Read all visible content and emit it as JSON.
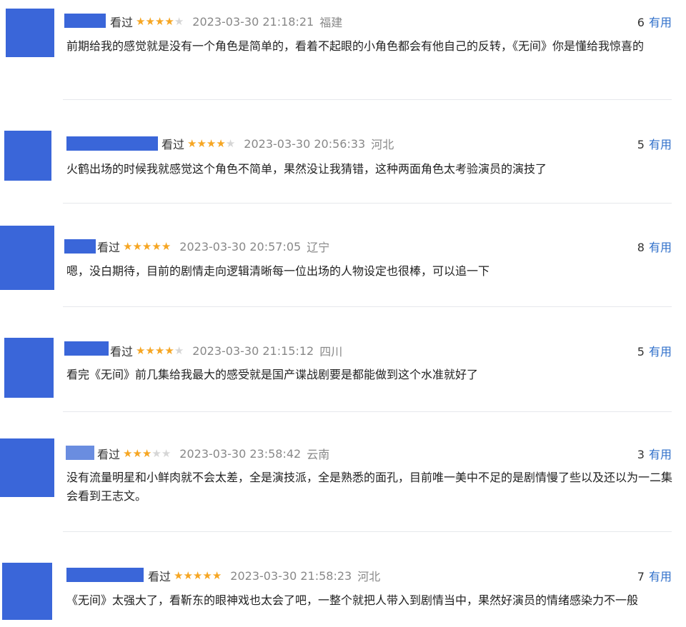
{
  "reviews": [
    {
      "watched": "看过",
      "rating": 4,
      "time": "2023-03-30 21:18:21",
      "region": "福建",
      "useful_count": "6",
      "useful_label": "有用",
      "content": "前期给我的感觉就是没有一个角色是简单的，看着不起眼的小角色都会有他自己的反转，《无间》你是懂给我惊喜的"
    },
    {
      "watched": "看过",
      "rating": 4,
      "time": "2023-03-30 20:56:33",
      "region": "河北",
      "useful_count": "5",
      "useful_label": "有用",
      "content": "火鹤出场的时候我就感觉这个角色不简单，果然没让我猜错，这种两面角色太考验演员的演技了"
    },
    {
      "watched": "看过",
      "rating": 5,
      "time": "2023-03-30 20:57:05",
      "region": "辽宁",
      "useful_count": "8",
      "useful_label": "有用",
      "content": "嗯，没白期待，目前的剧情走向逻辑清晰每一位出场的人物设定也很棒，可以追一下"
    },
    {
      "watched": "看过",
      "rating": 4,
      "time": "2023-03-30 21:15:12",
      "region": "四川",
      "useful_count": "5",
      "useful_label": "有用",
      "content": "看完《无间》前几集给我最大的感受就是国产谍战剧要是都能做到这个水准就好了"
    },
    {
      "watched": "看过",
      "rating": 3,
      "time": "2023-03-30 23:58:42",
      "region": "云南",
      "useful_count": "3",
      "useful_label": "有用",
      "content": "没有流量明星和小鲜肉就不会太差，全是演技派，全是熟悉的面孔，目前唯一美中不足的是剧情慢了些以及还以为一二集会看到王志文。"
    },
    {
      "watched": "看过",
      "rating": 5,
      "time": "2023-03-30 21:58:23",
      "region": "河北",
      "useful_count": "7",
      "useful_label": "有用",
      "content": "《无间》太强大了，看靳东的眼神戏也太会了吧，一整个就把人带入到剧情当中，果然好演员的情绪感染力不一般"
    }
  ]
}
